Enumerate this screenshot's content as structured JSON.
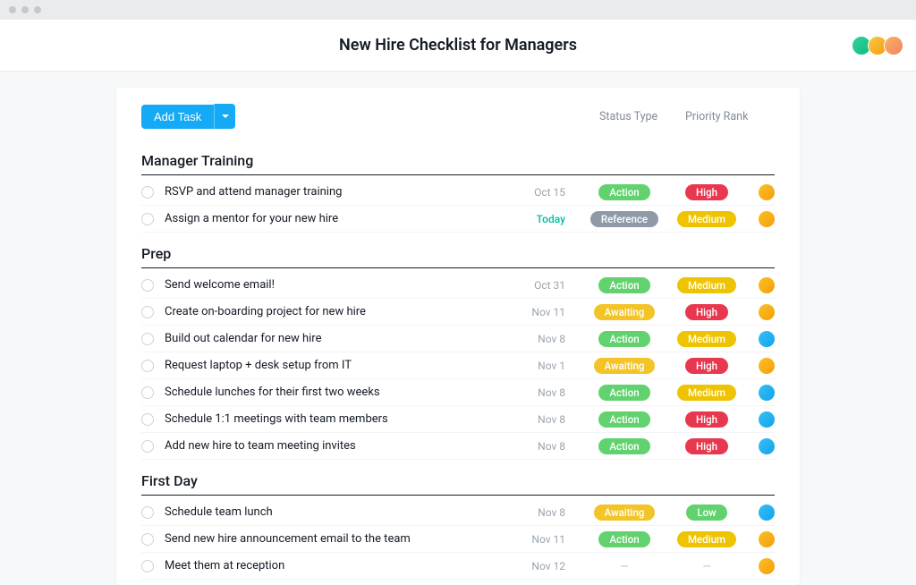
{
  "header": {
    "title": "New Hire Checklist for Managers"
  },
  "toolbar": {
    "add_task_label": "Add Task"
  },
  "columns": {
    "status_label": "Status Type",
    "priority_label": "Priority Rank"
  },
  "status_labels": {
    "action": "Action",
    "reference": "Reference",
    "awaiting": "Awaiting",
    "empty": "—"
  },
  "priority_labels": {
    "high": "High",
    "medium": "Medium",
    "low": "Low",
    "empty": "—"
  },
  "sections": [
    {
      "title": "Manager Training",
      "tasks": [
        {
          "name": "RSVP and attend manager training",
          "date": "Oct 15",
          "date_today": false,
          "status": "action",
          "priority": "high",
          "avatar": "av-orange"
        },
        {
          "name": "Assign a mentor for your new hire",
          "date": "Today",
          "date_today": true,
          "status": "reference",
          "priority": "medium",
          "avatar": "av-orange"
        }
      ]
    },
    {
      "title": "Prep",
      "tasks": [
        {
          "name": "Send welcome email!",
          "date": "Oct 31",
          "date_today": false,
          "status": "action",
          "priority": "medium",
          "avatar": "av-orange"
        },
        {
          "name": "Create on-boarding project for new hire",
          "date": "Nov 11",
          "date_today": false,
          "status": "awaiting",
          "priority": "high",
          "avatar": "av-orange"
        },
        {
          "name": "Build out calendar for new hire",
          "date": "Nov 8",
          "date_today": false,
          "status": "action",
          "priority": "medium",
          "avatar": "av-blue"
        },
        {
          "name": "Request laptop + desk setup from IT",
          "date": "Nov 1",
          "date_today": false,
          "status": "awaiting",
          "priority": "high",
          "avatar": "av-orange"
        },
        {
          "name": "Schedule lunches for their first two weeks",
          "date": "Nov 8",
          "date_today": false,
          "status": "action",
          "priority": "medium",
          "avatar": "av-blue"
        },
        {
          "name": "Schedule 1:1 meetings with team members",
          "date": "Nov 8",
          "date_today": false,
          "status": "action",
          "priority": "high",
          "avatar": "av-blue"
        },
        {
          "name": "Add new hire to team meeting invites",
          "date": "Nov 8",
          "date_today": false,
          "status": "action",
          "priority": "high",
          "avatar": "av-blue"
        }
      ]
    },
    {
      "title": "First Day",
      "tasks": [
        {
          "name": "Schedule team lunch",
          "date": "Nov 8",
          "date_today": false,
          "status": "awaiting",
          "priority": "low",
          "avatar": "av-blue"
        },
        {
          "name": "Send new hire announcement email to the team",
          "date": "Nov 11",
          "date_today": false,
          "status": "action",
          "priority": "medium",
          "avatar": "av-orange"
        },
        {
          "name": "Meet them at reception",
          "date": "Nov 12",
          "date_today": false,
          "status": "empty",
          "priority": "empty",
          "avatar": "av-orange"
        }
      ]
    }
  ]
}
